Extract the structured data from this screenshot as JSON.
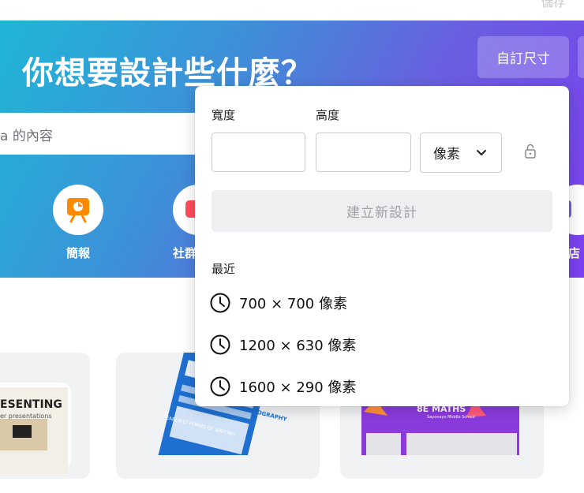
{
  "topbar": {
    "save_label": "儲存"
  },
  "hero": {
    "title": "你想要設計些什麼？",
    "custom_size_label": "自訂尺寸",
    "search_placeholder": "a 的內容",
    "categories": [
      {
        "label": "簡報",
        "icon": "presentation-icon",
        "color": "#ff8a00"
      },
      {
        "label": "社群",
        "icon": "social-icon",
        "color": "#ff4d5a"
      },
      {
        "label": "店",
        "icon": "store-icon",
        "color": "#6d5ff5"
      }
    ]
  },
  "cards": [
    {
      "title": "ESENTING",
      "subtitle": "er presentations"
    },
    {
      "title": "CALLIGRAPHY - TYPOGRAPHY",
      "subtitle": "EARLIEST FORMS OF WRITING"
    },
    {
      "title": "8E MATHS",
      "subtitle": "Sayonayo Middle School"
    }
  ],
  "custom_size_panel": {
    "width_label": "寬度",
    "height_label": "高度",
    "width_value": "",
    "height_value": "",
    "unit_value": "像素",
    "create_label": "建立新設計",
    "recent_label": "最近",
    "recent_items": [
      {
        "label": "700 × 700 像素"
      },
      {
        "label": "1200 × 630 像素"
      },
      {
        "label": "1600 × 290 像素"
      }
    ]
  },
  "colors": {
    "hero_gradient_start": "#1fb6d6",
    "hero_gradient_end": "#7b3ff0",
    "button_disabled_bg": "#eeeff1"
  }
}
